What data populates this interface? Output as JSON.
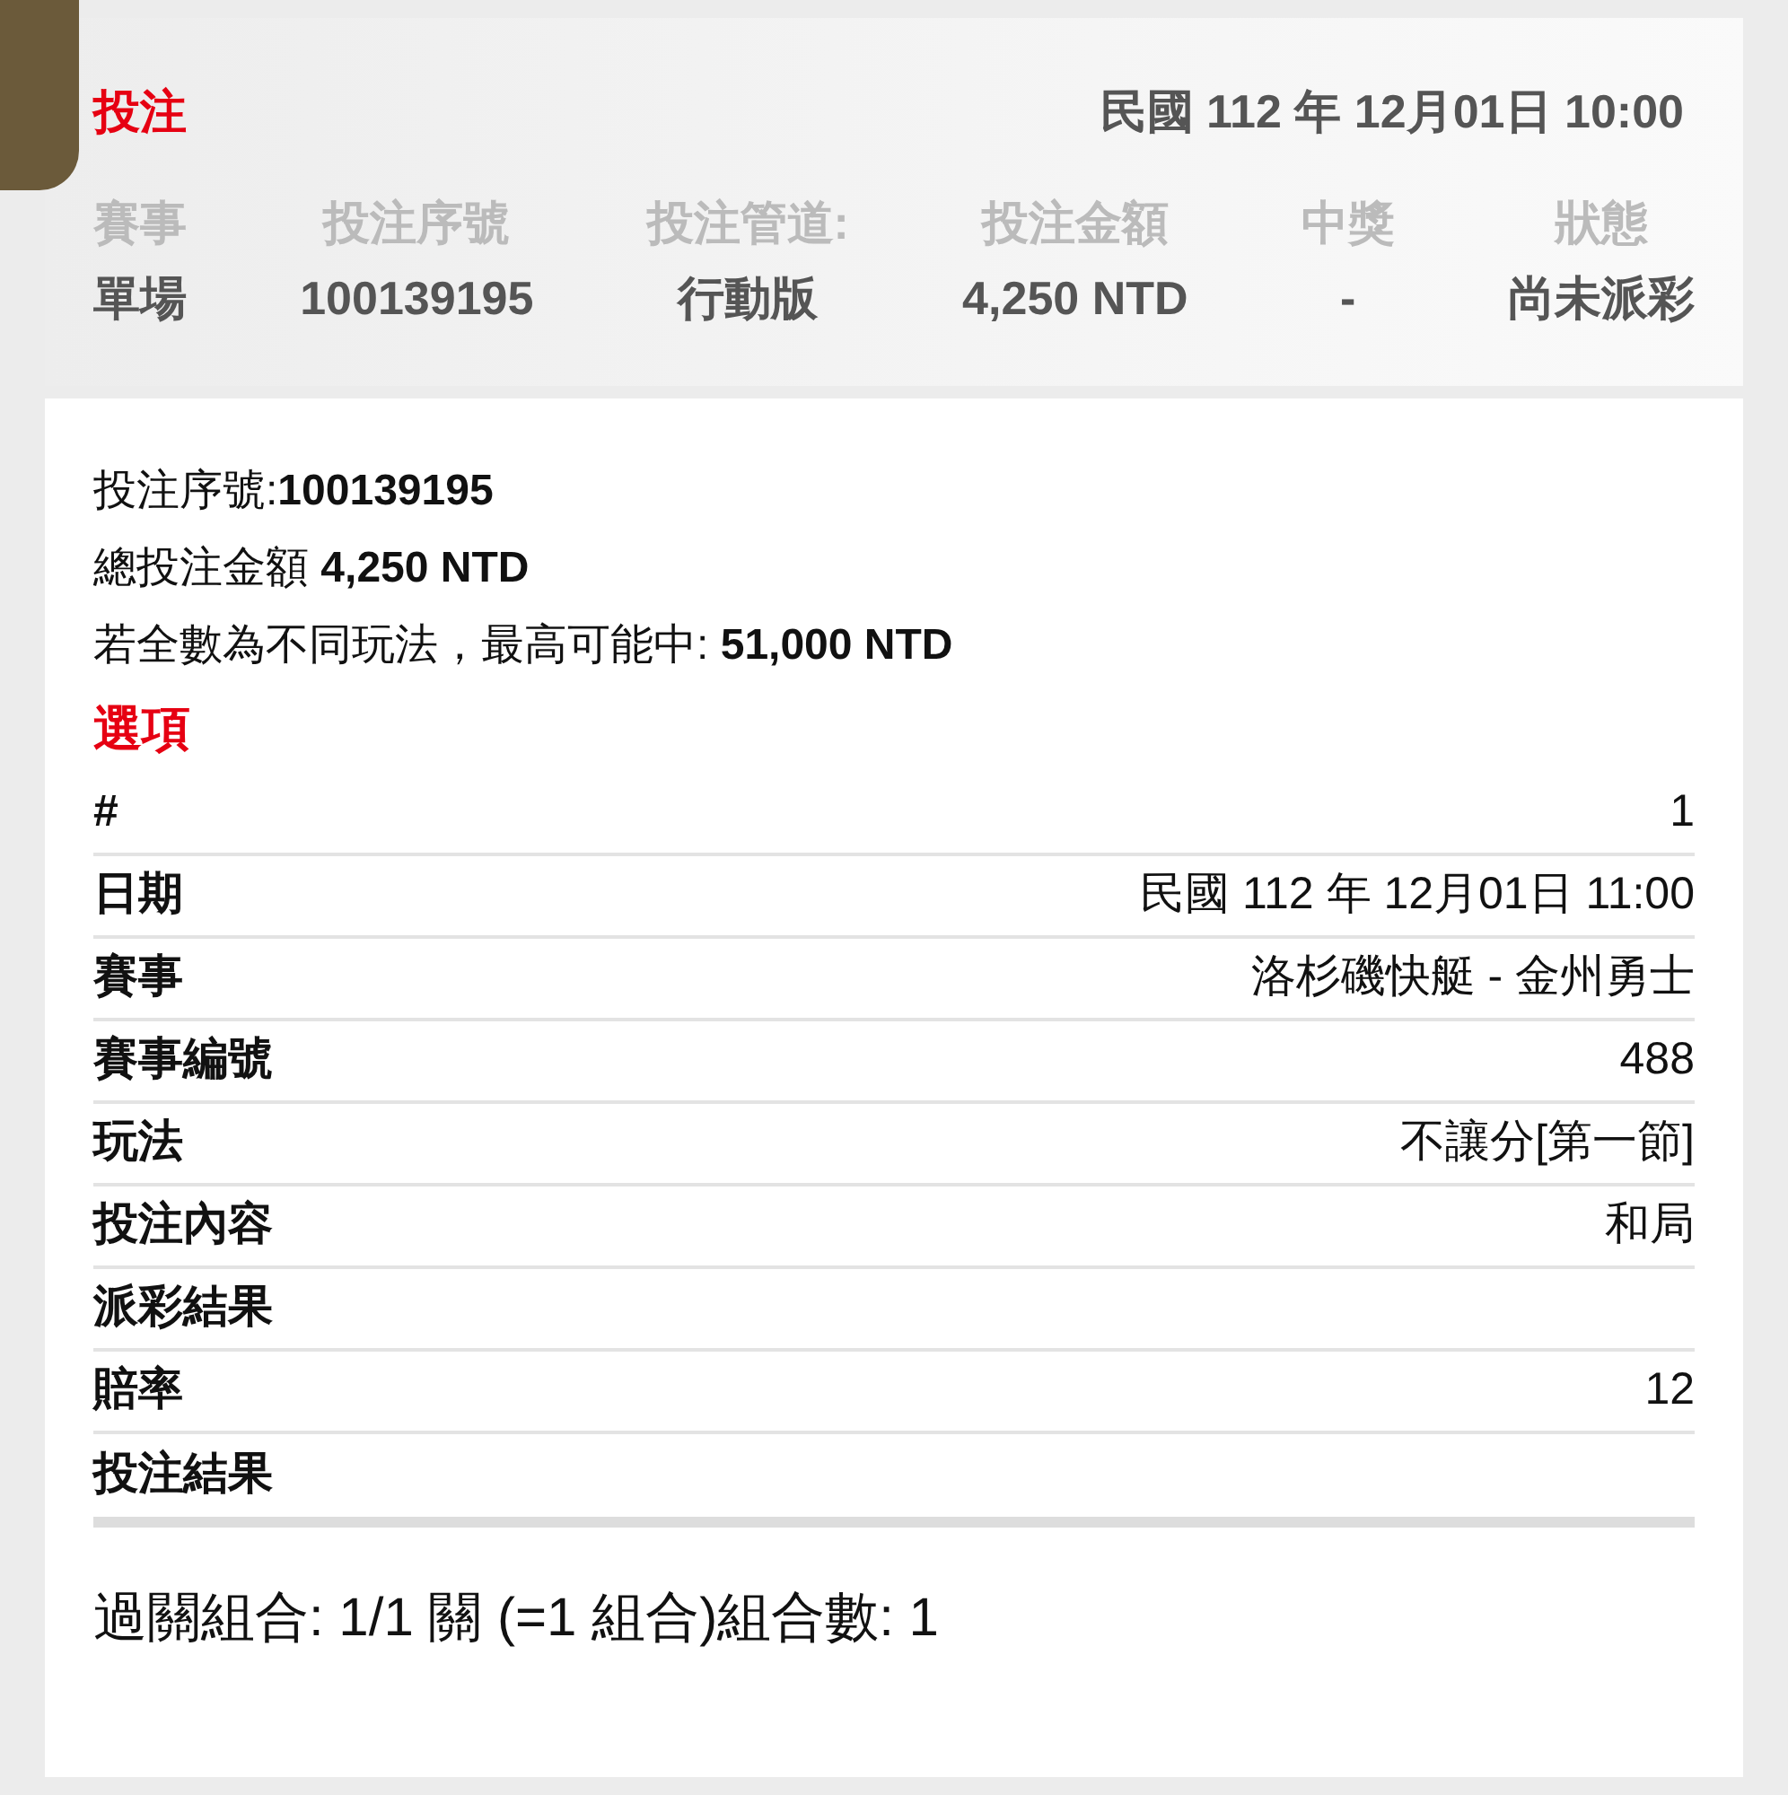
{
  "header": {
    "title": "投注",
    "datetime": "民國 112 年 12月01日 10:00"
  },
  "summary": {
    "columns": [
      {
        "label": "賽事",
        "value": "單場"
      },
      {
        "label": "投注序號",
        "value": "100139195"
      },
      {
        "label": "投注管道:",
        "value": "行動版"
      },
      {
        "label": "投注金額",
        "value": "4,250 NTD"
      },
      {
        "label": "中獎",
        "value": "-"
      },
      {
        "label": "狀態",
        "value": "尚未派彩"
      }
    ]
  },
  "details": {
    "lines": [
      "投注序號:**100139195**",
      "總投注金額 **4,250 NTD**",
      "若全數為不同玩法，最高可能中: **51,000 NTD**"
    ],
    "options_title": "選項",
    "rows": [
      {
        "label": "#",
        "value": "1"
      },
      {
        "label": "日期",
        "value": "民國 112 年 12月01日 11:00"
      },
      {
        "label": "賽事",
        "value": "洛杉磯快艇 - 金州勇士"
      },
      {
        "label": "賽事編號",
        "value": "488"
      },
      {
        "label": "玩法",
        "value": "不讓分[第一節]"
      },
      {
        "label": "投注內容",
        "value": "和局"
      },
      {
        "label": "派彩結果"
      },
      {
        "label": "賠率",
        "value": "12"
      },
      {
        "label": "投注結果"
      }
    ],
    "footer": "過關組合: 1/1 關 (=1 組合)組合數: 1"
  }
}
